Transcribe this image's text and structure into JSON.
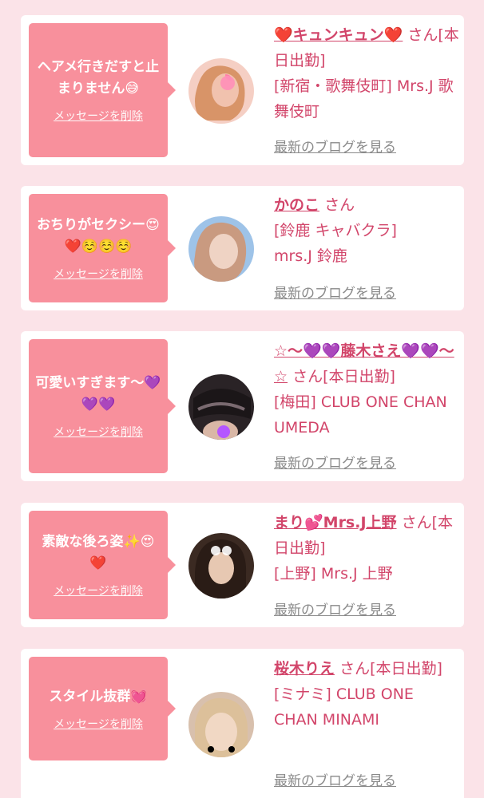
{
  "actions": {
    "delete_label": "メッセージを削除",
    "blog_label": "最新のブログを見る"
  },
  "entries": [
    {
      "message": "ヘアメ行きだすと止まりません😅",
      "name": "❤️キュンキュン❤️",
      "suffix": "さん[本日出勤]",
      "shop": "[新宿・歌舞伎町] Mrs.J 歌舞伎町",
      "colors": {
        "bg": "#f5cfc4",
        "skin": "#f1c2ae",
        "hair": "#d89468"
      }
    },
    {
      "message": "おちりがセクシー😍❤️☺️☺️☺️",
      "name": "かのこ",
      "suffix": "さん",
      "shop": "[鈴鹿 キャバクラ] mrs.J 鈴鹿",
      "colors": {
        "bg": "#9ec3e8",
        "skin": "#efd3c4",
        "hair": "#c99a80"
      }
    },
    {
      "message": "可愛いすぎます〜💜💜💜",
      "name": "☆〜💜💜藤木さえ💜💜〜☆",
      "suffix": "さん[本日出勤]",
      "shop": "[梅田] CLUB ONE CHAN UMEDA",
      "colors": {
        "bg": "#2a2326",
        "skin": "#d9b7a6",
        "hair": "#1b1618"
      }
    },
    {
      "message": "素敵な後ろ姿✨😍❤️",
      "name": "まり💕Mrs.J上野",
      "suffix": "さん[本日出勤]",
      "shop": "[上野] Mrs.J 上野",
      "colors": {
        "bg": "#3b2a22",
        "skin": "#e7c8b2",
        "hair": "#2a1c16"
      }
    },
    {
      "message": "スタイル抜群💓",
      "name": "桜木りえ",
      "suffix": "さん[本日出勤]",
      "shop": "[ミナミ] CLUB ONE CHAN MINAMI",
      "colors": {
        "bg": "#d8c0ad",
        "skin": "#f1d8c4",
        "hair": "#dcc09a"
      }
    }
  ]
}
